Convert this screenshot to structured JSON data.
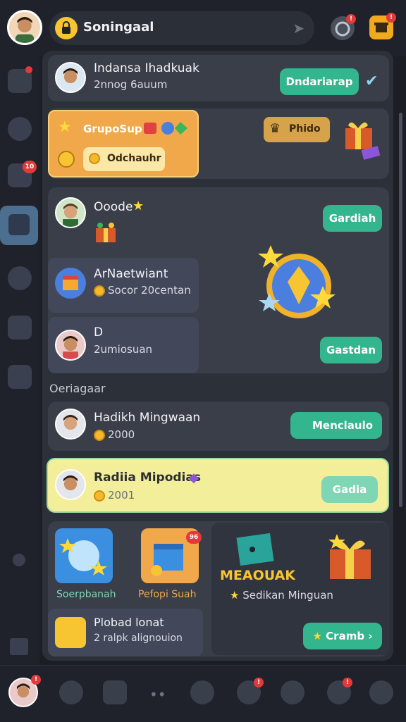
{
  "header": {
    "title": "Soningaal"
  },
  "profile_card": {
    "name": "Indansa Ihadkuak",
    "subtitle": "2nnog 6auum",
    "button": "Dndariarap"
  },
  "group_card": {
    "title": "GrupoSup",
    "button": "Odchauhr",
    "tag": "Phido"
  },
  "challenge_card": {
    "top": {
      "title": "Ooode",
      "button": "Gardiah"
    },
    "mid": {
      "title": "ArNaetwiant",
      "subtitle": "Socor 20centan"
    },
    "low": {
      "title": "D",
      "subtitle": "2umiosuan",
      "button": "Gastdan"
    }
  },
  "section_label": "Oeriagaar",
  "list": [
    {
      "title": "Hadikh Mingwaan",
      "value": "2000",
      "button": "Menclaulo"
    },
    {
      "title": "Radiia Mipodias",
      "value": "2001",
      "button": "Gadia"
    }
  ],
  "shop": {
    "tile1_label": "Soerpbanah",
    "tile2_label": "Pefopi Suah",
    "tile2_badge": "96",
    "promo_title": "MEAOUAK",
    "promo_subtitle": "Sedikan Minguan",
    "extra_title": "Plobad lonat",
    "extra_subtitle": "2 ralpk alignouion",
    "cta": "Cramb"
  },
  "badges": {
    "sidebar_notif": "10"
  },
  "colors": {
    "accent": "#33b58d",
    "highlight": "#f3ee9a",
    "orange": "#f0a84a"
  }
}
